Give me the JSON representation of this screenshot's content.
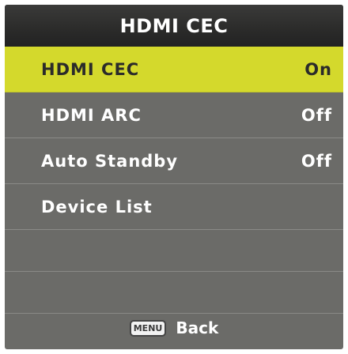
{
  "title": "HDMI CEC",
  "menu": [
    {
      "label": "HDMI CEC",
      "value": "On",
      "selected": true
    },
    {
      "label": "HDMI ARC",
      "value": "Off",
      "selected": false
    },
    {
      "label": "Auto Standby",
      "value": "Off",
      "selected": false
    },
    {
      "label": "Device List",
      "value": "",
      "selected": false
    }
  ],
  "footer": {
    "key_label": "MENU",
    "action_label": "Back"
  },
  "colors": {
    "highlight": "#d4d92c",
    "panel": "#6b6b68",
    "title_bar": "#2b2b2a"
  }
}
